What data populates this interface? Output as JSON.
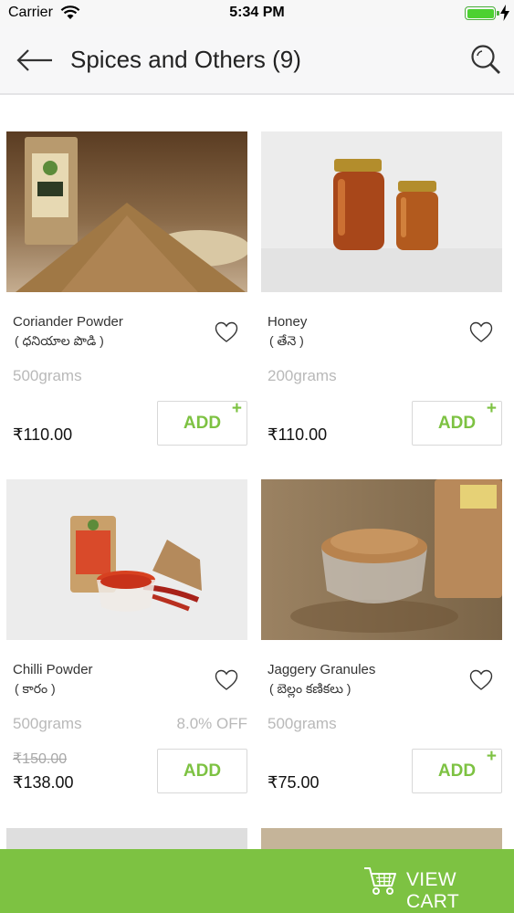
{
  "status_bar": {
    "carrier": "Carrier",
    "time": "5:34 PM"
  },
  "header": {
    "title": "Spices and Others (9)",
    "back_icon": "back-arrow-icon",
    "search_icon": "search-icon"
  },
  "products": [
    {
      "name": "Coriander Powder",
      "local_name": "( ధనియాల పొడి )",
      "weight": "500grams",
      "discount": "",
      "old_price": "",
      "price": "₹110.00",
      "add_label": "ADD",
      "add_plus": "+"
    },
    {
      "name": "Honey",
      "local_name": "( తేనె )",
      "weight": "200grams",
      "discount": "",
      "old_price": "",
      "price": "₹110.00",
      "add_label": "ADD",
      "add_plus": "+"
    },
    {
      "name": "Chilli Powder",
      "local_name": "( కారం )",
      "weight": "500grams",
      "discount": "8.0% OFF",
      "old_price": "₹150.00",
      "price": "₹138.00",
      "add_label": "ADD",
      "add_plus": ""
    },
    {
      "name": "Jaggery Granules",
      "local_name": "( బెల్లం కణికలు )",
      "weight": "500grams",
      "discount": "",
      "old_price": "",
      "price": "₹75.00",
      "add_label": "ADD",
      "add_plus": "+"
    }
  ],
  "cart": {
    "label": "VIEW CART",
    "icon": "cart-icon"
  },
  "colors": {
    "accent": "#7dc242",
    "muted_text": "#b9b9b9",
    "header_bg": "#f7f7f8"
  }
}
